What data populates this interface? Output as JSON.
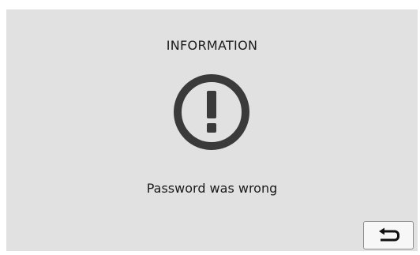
{
  "dialog": {
    "title": "INFORMATION",
    "icon": "exclamation-circle-icon",
    "message": "Password was wrong"
  },
  "controls": {
    "back_icon": "return-arrow-icon"
  },
  "colors": {
    "background": "#e1e1e1",
    "icon": "#3a3a3a",
    "text": "#1a1a1a",
    "button_bg": "#f7f7f7"
  }
}
